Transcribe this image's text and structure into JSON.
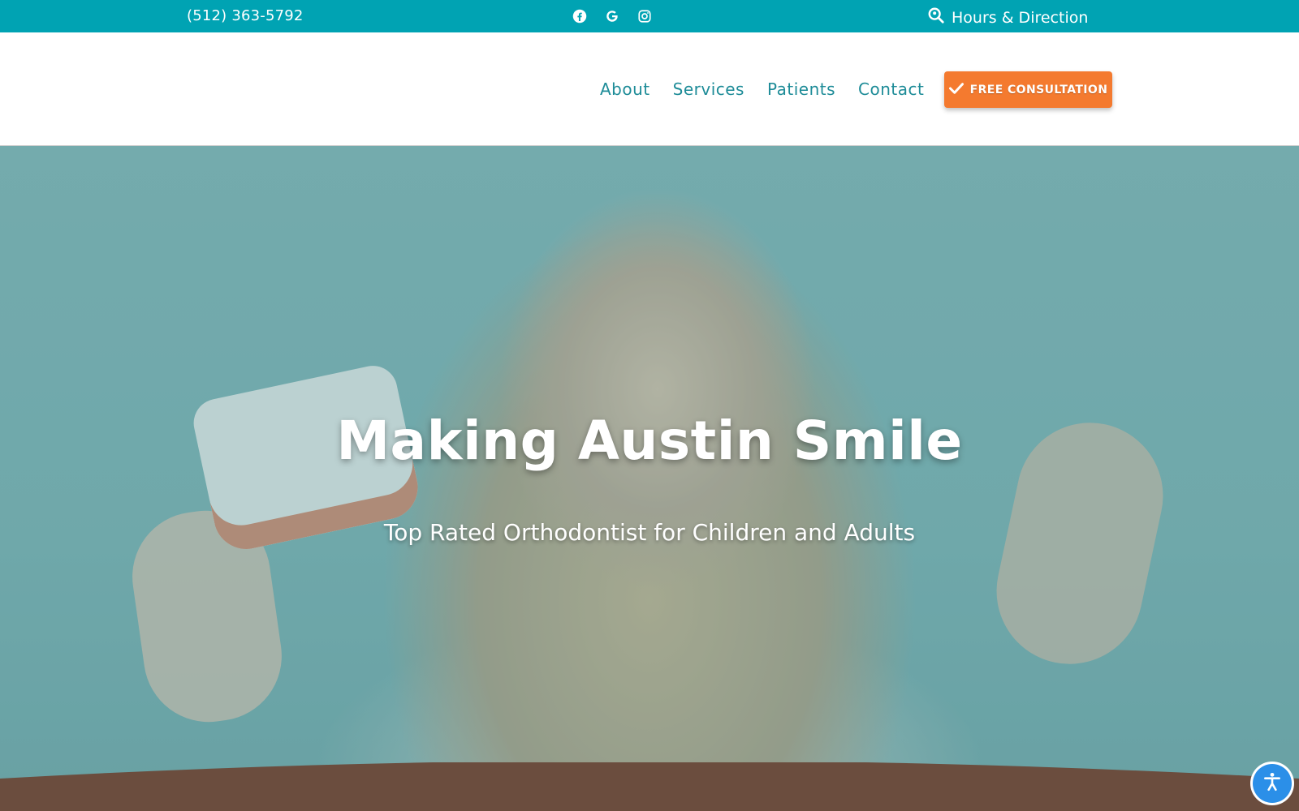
{
  "topbar": {
    "phone": "(512) 363-5792",
    "social_icons": [
      "facebook-icon",
      "google-icon",
      "instagram-icon"
    ],
    "hours_label": "Hours & Direction",
    "hours_icon": "map-search-icon",
    "background": "#00a3b3"
  },
  "header": {
    "nav": [
      {
        "label": "About"
      },
      {
        "label": "Services"
      },
      {
        "label": "Patients"
      },
      {
        "label": "Contact"
      }
    ],
    "cta": {
      "label": "FREE CONSULTATION",
      "icon": "checkmark-icon",
      "color": "#f47a2f"
    }
  },
  "hero": {
    "title": "Making Austin Smile",
    "subtitle": "Top Rated Orthodontist for Children and Adults",
    "image": "smiling-girl-holding-braces-model-and-clear-aligner",
    "wave_color": "#6b4d3e"
  },
  "accessibility_button": {
    "icon": "accessibility-icon",
    "color": "#2b8fe8"
  }
}
